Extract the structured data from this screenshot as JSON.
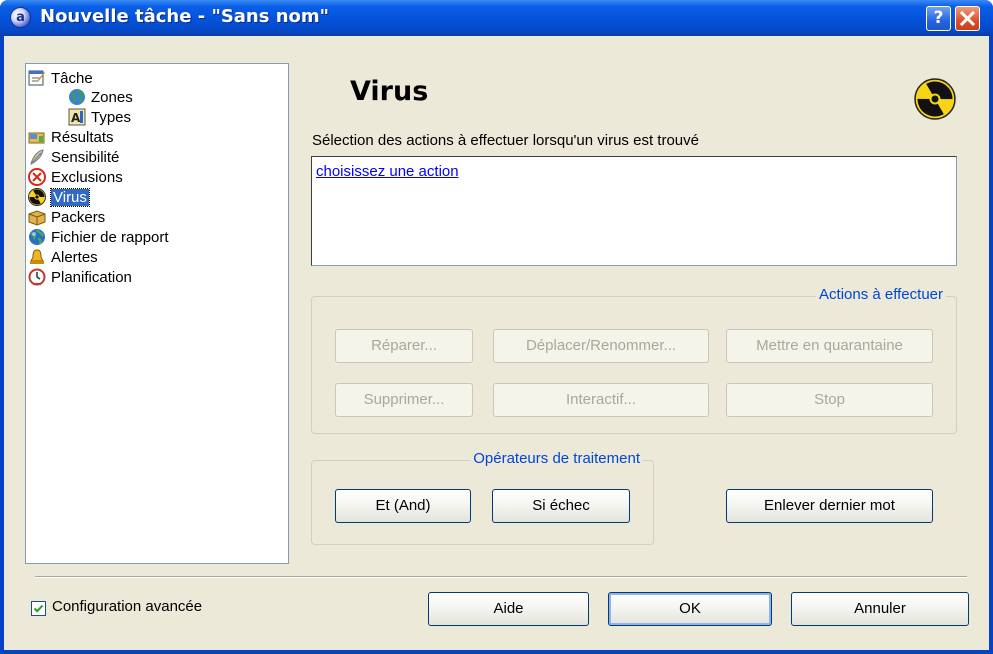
{
  "window": {
    "title": "Nouvelle tâche - \"Sans nom\"",
    "help_label": "?"
  },
  "tree": {
    "items": [
      {
        "label": "Tâche",
        "icon": "task-icon"
      },
      {
        "label": "Zones",
        "icon": "globe-icon"
      },
      {
        "label": "Types",
        "icon": "types-icon"
      },
      {
        "label": "Résultats",
        "icon": "results-icon"
      },
      {
        "label": "Sensibilité",
        "icon": "feather-icon"
      },
      {
        "label": "Exclusions",
        "icon": "exclusion-icon"
      },
      {
        "label": "Virus",
        "icon": "radioactive-icon",
        "selected": true
      },
      {
        "label": "Packers",
        "icon": "package-icon"
      },
      {
        "label": "Fichier de rapport",
        "icon": "report-globe-icon"
      },
      {
        "label": "Alertes",
        "icon": "bell-icon"
      },
      {
        "label": "Planification",
        "icon": "clock-icon"
      }
    ]
  },
  "main": {
    "heading": "Virus",
    "description": "Sélection des actions à effectuer lorsqu'un virus est trouvé",
    "action_link": "choisissez une action",
    "actions_group": {
      "title": "Actions à effectuer",
      "buttons": [
        "Réparer...",
        "Déplacer/Renommer...",
        "Mettre en quarantaine",
        "Supprimer...",
        "Interactif...",
        "Stop"
      ]
    },
    "operators_group": {
      "title": "Opérateurs de traitement",
      "and_label": "Et (And)",
      "fail_label": "Si échec"
    },
    "remove_last_label": "Enlever dernier mot"
  },
  "footer": {
    "advanced_label": "Configuration avancée",
    "advanced_checked": true,
    "help_label": "Aide",
    "ok_label": "OK",
    "cancel_label": "Annuler"
  },
  "colors": {
    "titlebar": "#0654dc",
    "dialog_bg": "#ece9d8",
    "group_title": "#0046d5",
    "selection": "#316ac5",
    "link": "#0000ff"
  }
}
